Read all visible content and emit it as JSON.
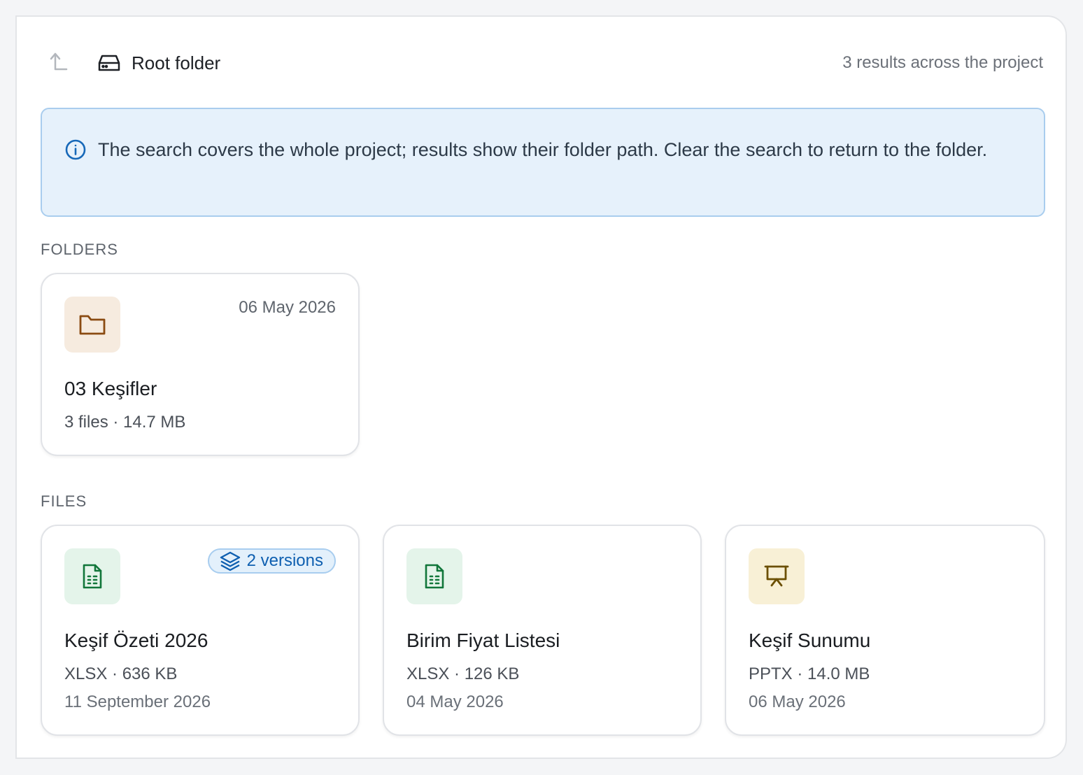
{
  "header": {
    "up_icon": "arrow-up-left-icon",
    "drive_icon": "hard-drive-icon",
    "location_label": "Root folder",
    "result_count": "3 results across the project"
  },
  "banner": {
    "icon": "info-icon",
    "text": "The search covers the whole project; results show their folder path. Clear the search to return to the folder."
  },
  "sections": {
    "folders_label": "FOLDERS",
    "files_label": "FILES"
  },
  "folders": [
    {
      "icon": "folder-icon",
      "date": "06 May 2026",
      "name": "03 Keşifler",
      "meta": "3 files · 14.7 MB"
    }
  ],
  "files": [
    {
      "icon": "spreadsheet-icon",
      "badge": "2 versions",
      "badge_icon": "layers-icon",
      "name": "Keşif Özeti 2026",
      "meta": "XLSX · 636 KB",
      "date": "11 September 2026"
    },
    {
      "icon": "spreadsheet-icon",
      "name": "Birim Fiyat Listesi",
      "meta": "XLSX · 126 KB",
      "date": "04 May 2026"
    },
    {
      "icon": "presentation-icon",
      "name": "Keşif Sunumu",
      "meta": "PPTX · 14.0 MB",
      "date": "06 May 2026"
    }
  ],
  "colors": {
    "accent_blue": "#0e5fb0",
    "folder_brown": "#8a4b12",
    "sheet_green": "#11763a",
    "slides_olive": "#6b4f00"
  }
}
